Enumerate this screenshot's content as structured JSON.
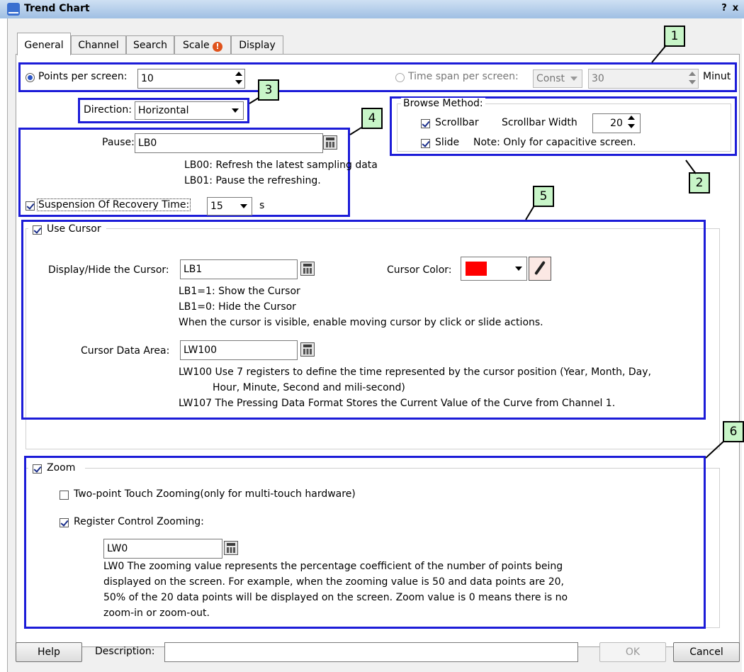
{
  "window": {
    "title": "Trend Chart",
    "help_glyph": "?",
    "close_glyph": "x"
  },
  "tabs": [
    {
      "label": "General",
      "active": true
    },
    {
      "label": "Channel"
    },
    {
      "label": "Search"
    },
    {
      "label": "Scale",
      "badge": "!"
    },
    {
      "label": "Display"
    }
  ],
  "callouts": [
    "1",
    "2",
    "3",
    "4",
    "5",
    "6"
  ],
  "row1": {
    "points_label": "Points per screen:",
    "points_value": "10",
    "time_label": "Time span per screen:",
    "time_mode": "Const",
    "time_value": "30",
    "time_unit": "Minut"
  },
  "direction": {
    "label": "Direction:",
    "value": "Horizontal"
  },
  "browse": {
    "title": "Browse Method:",
    "scrollbar_label": "Scrollbar",
    "scrollbar_checked": true,
    "width_label": "Scrollbar Width",
    "width_value": "20",
    "slide_label": "Slide",
    "slide_checked": true,
    "note": "Note: Only for capacitive screen."
  },
  "pause": {
    "label": "Pause:",
    "value": "LB0",
    "hint1": "LB00: Refresh the latest sampling data",
    "hint2": "LB01: Pause the refreshing.",
    "suspension_label": "Suspension Of Recovery Time:",
    "suspension_checked": true,
    "suspension_value": "15",
    "suspension_unit": "s"
  },
  "cursor": {
    "group_label": "Use Cursor",
    "checked": true,
    "display_label": "Display/Hide the Cursor:",
    "display_value": "LB1",
    "color_label": "Cursor Color:",
    "color": "#ff0000",
    "hint1": "LB1=1: Show the Cursor",
    "hint2": "LB1=0: Hide the Cursor",
    "hint3": "When the cursor is visible, enable moving cursor by click or slide actions.",
    "data_label": "Cursor Data Area:",
    "data_value": "LW100",
    "data_hint1a": "LW100 Use 7 registers to define the time represented by the cursor position (Year, Month, Day,",
    "data_hint1b": "Hour, Minute, Second and mili-second)",
    "data_hint2": "LW107 The Pressing Data Format Stores the Current Value of the Curve from Channel 1."
  },
  "zoom": {
    "group_label": "Zoom",
    "checked": true,
    "two_point_label": "Two-point Touch Zooming(only for multi-touch hardware)",
    "two_point_checked": false,
    "register_label": "Register Control Zooming:",
    "register_checked": true,
    "register_value": "LW0",
    "desc1": "LW0 The zooming value represents the percentage coefficient of the number of points being",
    "desc2": "displayed on the screen. For example, when the zooming value is 50 and data points are 20,",
    "desc3": "50% of the 20 data points will be displayed on the screen.  Zoom value is 0 means there is no",
    "desc4": "zoom-in or zoom-out."
  },
  "footer": {
    "help": "Help",
    "description_label": "Description:",
    "description_value": "",
    "ok": "OK",
    "cancel": "Cancel"
  },
  "colors": {
    "highlight_border": "#1c1cd8",
    "callout_fill": "#c8f5c8",
    "title_bar": "#9fbfe3"
  }
}
